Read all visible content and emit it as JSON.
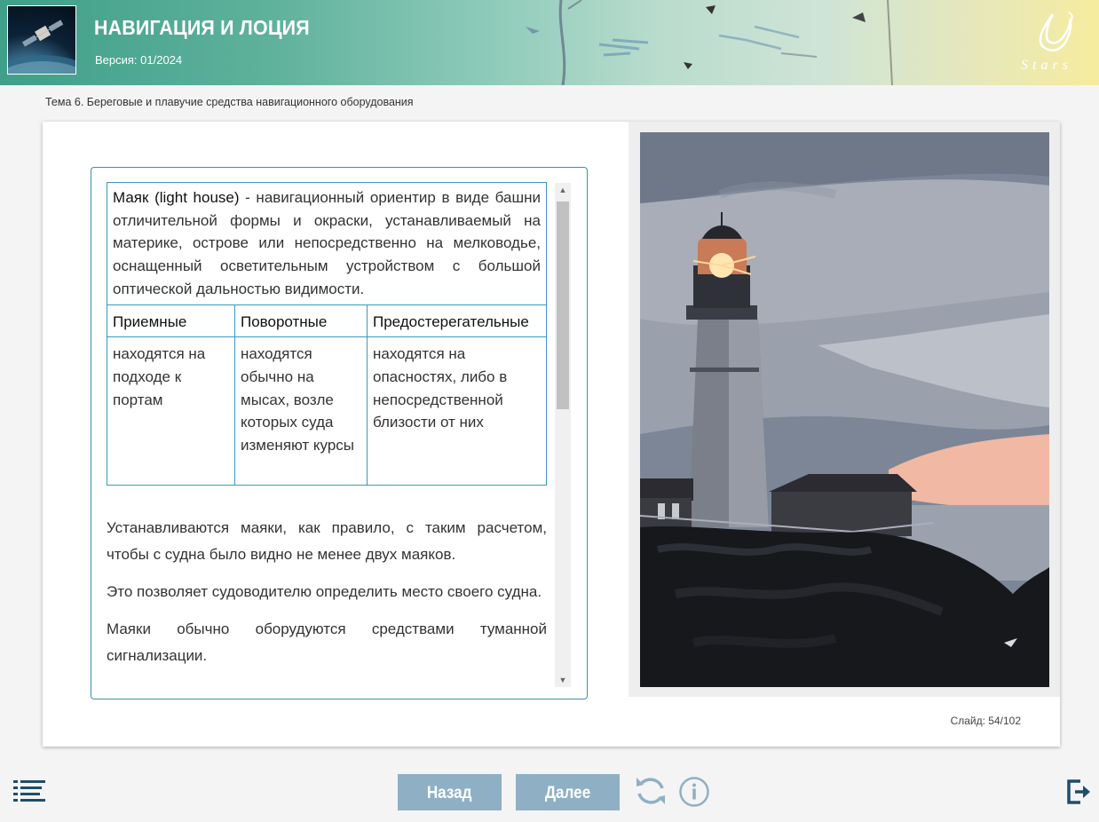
{
  "header": {
    "title": "НАВИГАЦИЯ И ЛОЦИЯ",
    "version": "Версия: 01/2024",
    "logo_text": "Stars"
  },
  "topic": "Тема 6. Береговые и плавучие средства навигационного оборудования",
  "content": {
    "definition_term": "Маяк (light house)",
    "definition_text": " - навигационный ориентир в виде башни отличительной формы и окраски, устанавливаемый на материке, острове или непосредственно на мелководье, оснащенный осветительным устройством с большой оптической дальностью видимости.",
    "columns": [
      {
        "header": "Приемные",
        "text": "находятся на подходе к портам"
      },
      {
        "header": "Поворотные",
        "text": "находятся обычно на мысах, возле которых суда изменяют курсы"
      },
      {
        "header": "Предостерегательные",
        "text": "находятся на опасностях, либо в непосредственной близости от них"
      }
    ],
    "paragraphs": [
      "Устанавливаются маяки, как правило, с таким расчетом, чтобы с судна было видно не менее двух маяков.",
      "Это позволяет судоводителю определить место своего судна.",
      "Маяки обычно оборудуются средствами туманной сигнализации."
    ]
  },
  "slide_counter": "Слайд: 54/102",
  "nav": {
    "back_label": "Назад",
    "next_label": "Далее"
  },
  "icons": {
    "menu": "menu-icon",
    "reload": "reload-icon",
    "info": "info-icon",
    "exit": "exit-icon"
  },
  "colors": {
    "accent": "#3b8fb0",
    "button": "#8fb0c4",
    "icon": "#1d4e6b"
  }
}
